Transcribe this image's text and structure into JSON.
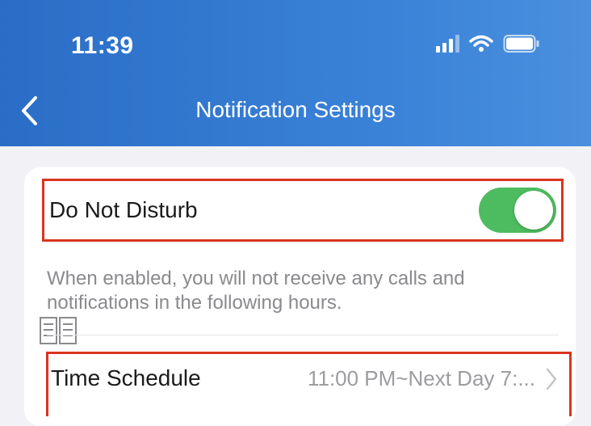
{
  "status_bar": {
    "time": "11:39"
  },
  "header": {
    "title": "Notification Settings"
  },
  "dnd": {
    "label": "Do Not Disturb",
    "enabled": true
  },
  "description": {
    "line1": "When enabled, you will not receive any calls and",
    "line2": "notifications in the following hours."
  },
  "schedule": {
    "label": "Time Schedule",
    "value": "11:00 PM~Next Day 7:..."
  },
  "colors": {
    "header": "#2f74cc",
    "toggle_on": "#4dbb5f",
    "highlight": "#d9341f"
  }
}
